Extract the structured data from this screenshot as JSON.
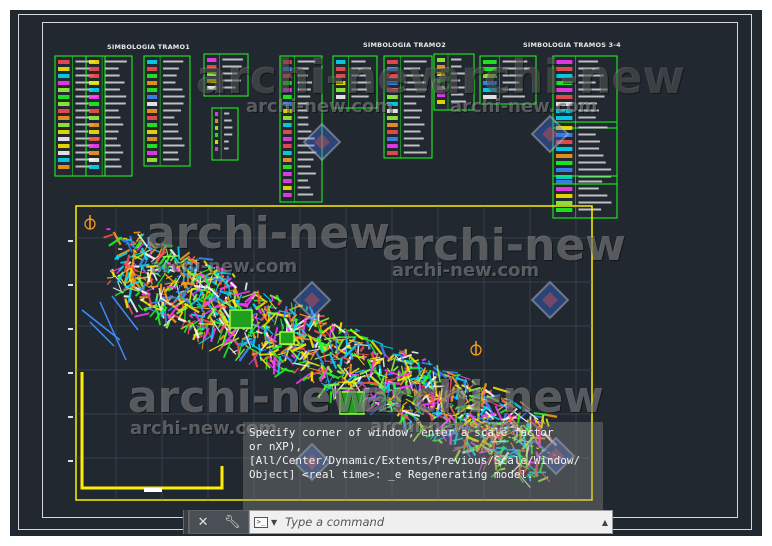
{
  "sheet": {
    "legend_titles": [
      "SIMBOLOGIA TRAMO1",
      "SIMBOLOGIA TRAMO2",
      "SIMBOLOGIA TRAMOS 3-4"
    ]
  },
  "watermark": {
    "brand": "archi-new",
    "site": "archi-new.com"
  },
  "command_line": {
    "history": [
      "Specify corner of window, enter a scale factor",
      "or nXP),",
      "[All/Center/Dynamic/Extents/Previous/Scale/Window/",
      "Object] <real time>: _e Regenerating model."
    ],
    "placeholder": "Type a command",
    "prompt_glyph": ">_"
  },
  "icons": {
    "close": "close-icon",
    "customize": "wrench-icon",
    "prompt": "command-prompt-icon",
    "recent": "chevron-down-icon",
    "scroll": "chevron-up-icon"
  },
  "colors": {
    "model_space": "#212830",
    "legend_border": "#1eff1e",
    "viewport_frame": "#ffee00"
  }
}
